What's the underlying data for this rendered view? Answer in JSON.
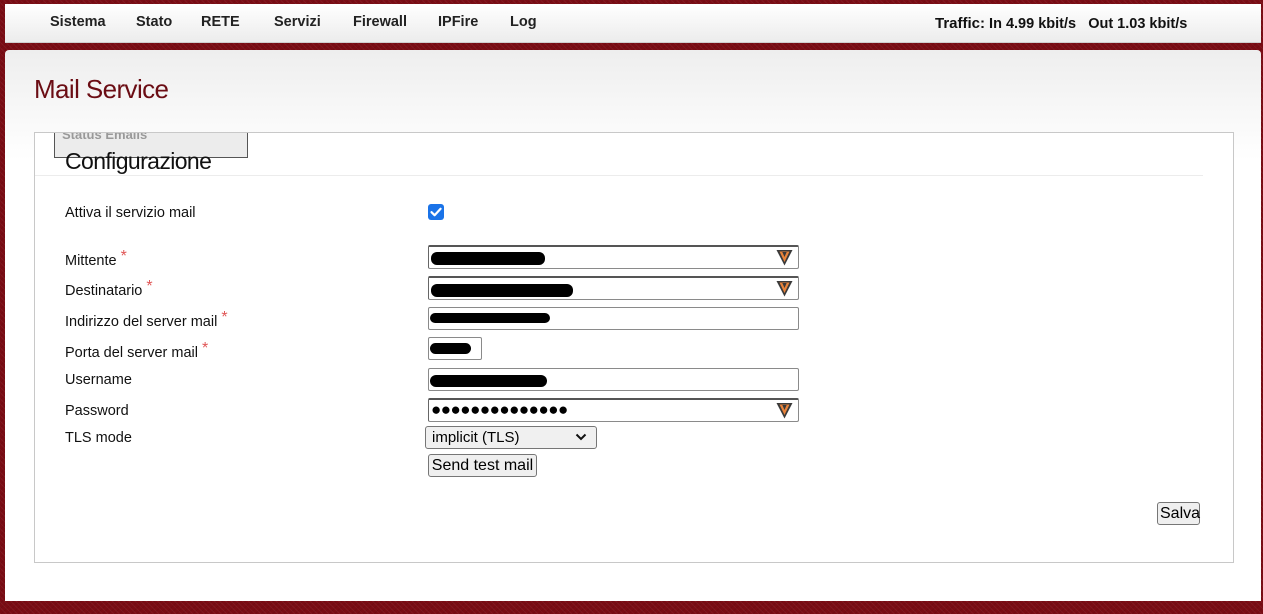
{
  "menu": {
    "items": [
      "Sistema",
      "Stato",
      "RETE",
      "Servizi",
      "Firewall",
      "IPFire",
      "Log"
    ]
  },
  "traffic": {
    "label": "Traffic:",
    "in": "In 4.99 kbit/s",
    "out": "Out 1.03 kbit/s"
  },
  "page": {
    "title": "Mail Service"
  },
  "tabs": {
    "status_emails": "Status Emails"
  },
  "config": {
    "title": "Configurazione",
    "enable_label": "Attiva il servizio mail",
    "enable_checked": true,
    "sender_label": "Mittente",
    "recipient_label": "Destinatario",
    "server_label": "Indirizzo del server mail",
    "port_label": "Porta del server mail",
    "username_label": "Username",
    "password_label": "Password",
    "password_mask": "●●●●●●●●●●●●●●",
    "tls_label": "TLS mode",
    "tls_selected": "implicit (TLS)",
    "required_mark": "*",
    "test_button": "Send test mail",
    "save_button": "Salva"
  },
  "colors": {
    "accent": "#7a0c14",
    "title": "#6b0d14",
    "required": "#e05555",
    "checkbox": "#1a73e8"
  },
  "icons": {
    "password_manager": "password-manager-icon"
  }
}
